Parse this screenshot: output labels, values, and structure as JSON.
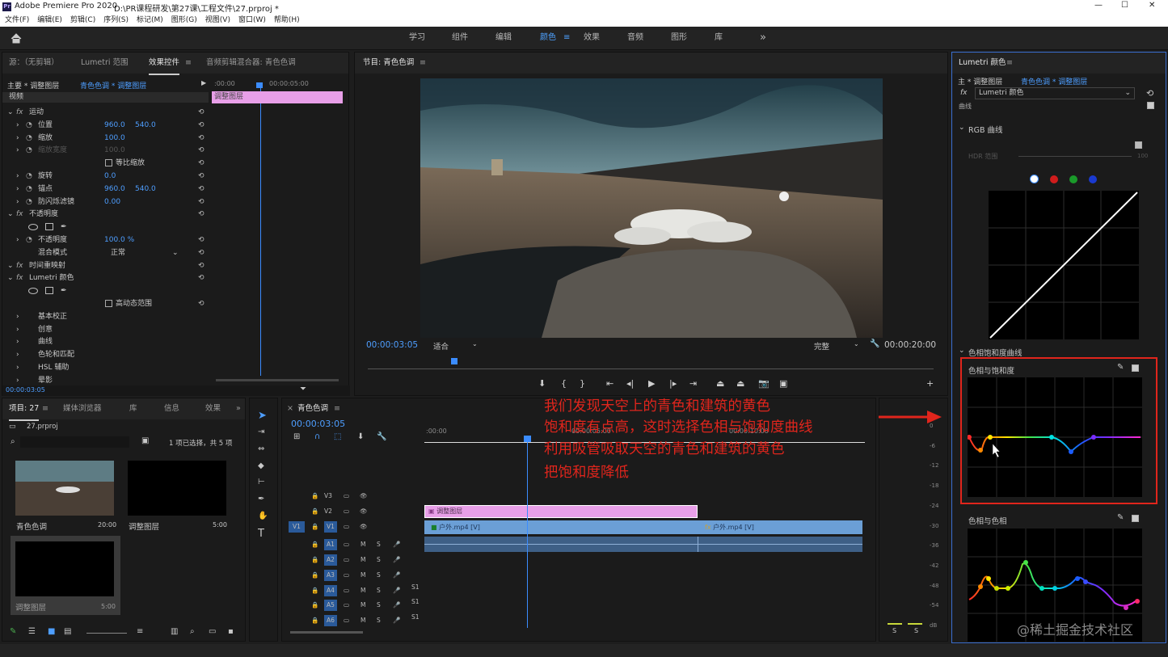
{
  "title": {
    "app": "Adobe Premiere Pro 2020",
    "path": "D:\\PR课程研发\\第27课\\工程文件\\27.prproj *",
    "min": "—",
    "max": "☐",
    "close": "✕"
  },
  "menu": [
    "文件(F)",
    "编辑(E)",
    "剪辑(C)",
    "序列(S)",
    "标记(M)",
    "图形(G)",
    "视图(V)",
    "窗口(W)",
    "帮助(H)"
  ],
  "workspaces": [
    "学习",
    "组件",
    "编辑",
    "颜色",
    "效果",
    "音频",
    "图形",
    "库"
  ],
  "ws_active": "颜色",
  "ws_more": "»",
  "effects_panel": {
    "tabs": [
      "源：（无剪辑）",
      "Lumetri 范围",
      "效果控件",
      "音频剪辑混合器: 青色色调"
    ],
    "master": "主要 * 调整图层",
    "seq": "青色色调 * 调整图层",
    "tc_start": ":00:00",
    "tc_mid": "00:00:05:00",
    "clip": "调整图层",
    "video": "视频",
    "rows": [
      {
        "label": "运动",
        "fx": true
      },
      {
        "label": "位置",
        "v1": "960.0",
        "v2": "540.0"
      },
      {
        "label": "缩放",
        "v1": "100.0"
      },
      {
        "label": "缩放宽度",
        "v1": "100.0",
        "dim": true
      },
      {
        "label": "等比缩放",
        "check": true
      },
      {
        "label": "旋转",
        "v1": "0.0"
      },
      {
        "label": "锚点",
        "v1": "960.0",
        "v2": "540.0"
      },
      {
        "label": "防闪烁滤镜",
        "v1": "0.00"
      },
      {
        "label": "不透明度",
        "fx": true
      },
      {
        "label": "",
        "shapes": true
      },
      {
        "label": "不透明度",
        "v1": "100.0 %"
      },
      {
        "label": "混合模式",
        "select": "正常"
      },
      {
        "label": "时间重映射",
        "fx": true
      },
      {
        "label": "Lumetri 颜色",
        "fx": true
      },
      {
        "label": "",
        "shapes": true
      },
      {
        "label": "高动态范围",
        "check": true
      },
      {
        "label": "基本校正"
      },
      {
        "label": "创意"
      },
      {
        "label": "曲线"
      },
      {
        "label": "色轮和匹配"
      },
      {
        "label": "HSL 辅助"
      },
      {
        "label": "晕影"
      }
    ],
    "timecode": "00:00:03:05"
  },
  "program": {
    "tab": "节目: 青色色调",
    "timecode": "00:00:03:05",
    "fit": "适合",
    "quality": "完整",
    "duration": "00:00:20:00"
  },
  "project": {
    "tabs": [
      "项目: 27",
      "媒体浏览器",
      "库",
      "信息",
      "效果"
    ],
    "file": "27.prproj",
    "selection": "1 项已选择，共 5 项",
    "items": [
      {
        "name": "青色色调",
        "dur": "20:00"
      },
      {
        "name": "调整图层",
        "dur": "5:00"
      },
      {
        "name": "调整图层",
        "dur": "5:00"
      }
    ]
  },
  "timeline": {
    "tab": "青色色调",
    "timecode": "00:00:03:05",
    "ruler": [
      ":00:00",
      "00:00:05:00",
      "00:00:10:00"
    ],
    "tracks_v": [
      "V3",
      "V2",
      "V1"
    ],
    "tracks_a": [
      "A1",
      "A2",
      "A3",
      "A4",
      "A5",
      "A6"
    ],
    "v1src": "V1",
    "clip_adj": "调整图层",
    "clip_v1a": "户外.mp4 [V]",
    "clip_v1b": "户外.mp4 [V]",
    "mute": "M",
    "solo": "S",
    "sub": "S1"
  },
  "meter": {
    "ticks": [
      "0",
      "-6",
      "-12",
      "-18",
      "-24",
      "-30",
      "-36",
      "-42",
      "-48",
      "-54",
      "dB"
    ],
    "solo": [
      "S",
      "S"
    ]
  },
  "lumetri": {
    "tab": "Lumetri 颜色",
    "master": "主 * 调整图层",
    "seq": "青色色调 * 调整图层",
    "effect": "Lumetri 颜色",
    "curve_section": "曲线",
    "rgb_curve": "RGB 曲线",
    "hdr": "HDR 范围",
    "hdr_val": "100",
    "hue_sat_section": "色相饱和度曲线",
    "hue_vs_sat": "色相与饱和度",
    "hue_vs_hue": "色相与色相"
  },
  "annotation": {
    "lines": [
      "我们发现天空上的青色和建筑的黄色",
      "饱和度有点高，这时选择色相与饱和度曲线",
      "利用吸管吸取天空的青色和建筑的黄色",
      "把饱和度降低"
    ],
    "color": "#e0251c"
  },
  "watermark": "@稀土掘金技术社区",
  "colors": {
    "accent": "#4e9eff",
    "clip_pink": "#e89fe8",
    "clip_blue": "#6b9fd6",
    "highlight": "#e0251c"
  }
}
